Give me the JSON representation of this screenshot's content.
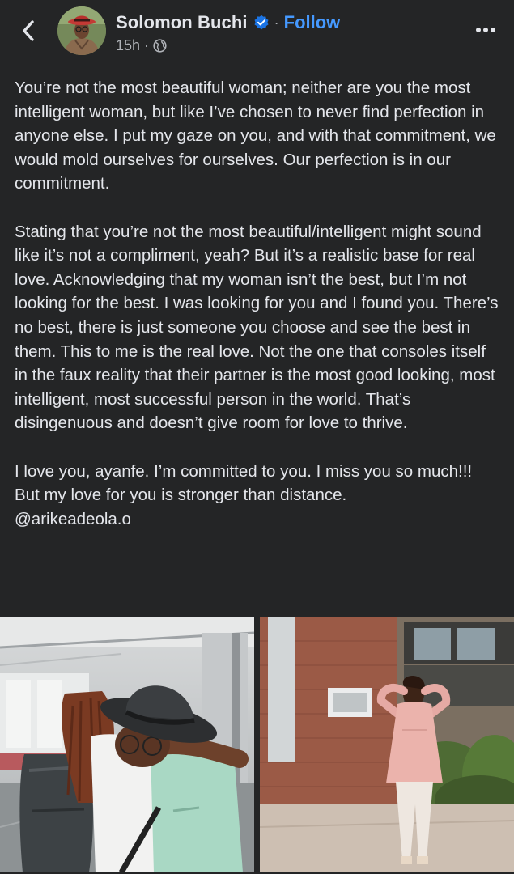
{
  "header": {
    "author_name": "Solomon Buchi",
    "separator": "·",
    "follow_label": "Follow",
    "timestamp": "15h",
    "meta_separator": "·",
    "icons": {
      "back": "chevron-left-icon",
      "verified": "verified-badge-icon",
      "privacy": "globe-icon",
      "more": "more-options-icon"
    }
  },
  "post": {
    "paragraph_1": "You’re not the most beautiful woman; neither are you the most intelligent woman, but like I’ve chosen to never find perfection in anyone else. I put my gaze on you, and with that commitment, we would mold ourselves for ourselves. Our perfection is in our commitment.",
    "paragraph_2": "Stating that you’re not the most beautiful/intelligent might sound like it’s not a compliment, yeah? But it’s a realistic base for real love. Acknowledging that my woman isn’t the best, but I’m not looking for the best. I was looking for you and I found you. There’s no best, there is just someone you choose and see the best in them. This to me is the real love. Not the one that consoles itself in the faux reality that their partner is the most good looking, most intelligent, most successful person in the world. That’s disingenuous and doesn’t give room for love to thrive.",
    "paragraph_3": "I love you, ayanfe. I’m committed to you. I miss you so much!!! But my love for you is stronger than distance.",
    "mention": "@arikeadeola.o"
  },
  "colors": {
    "background": "#242526",
    "text": "#e4e6eb",
    "secondary_text": "#b0b3b8",
    "follow_link": "#4599ff",
    "verified_badge": "#1b74e4"
  }
}
